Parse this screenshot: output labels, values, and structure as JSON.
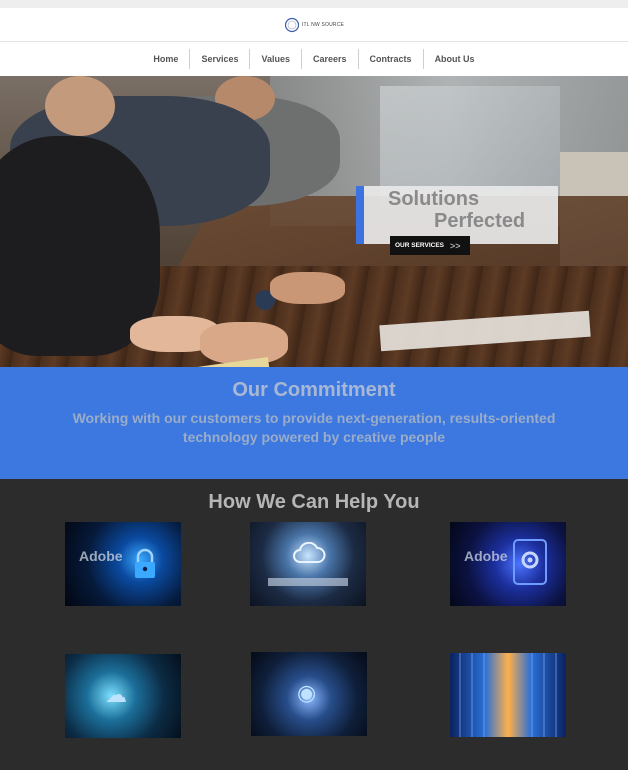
{
  "header": {
    "logo_text": "ITL NW SOURCE"
  },
  "nav": {
    "items": [
      "Home",
      "Services",
      "Values",
      "Careers",
      "Contracts",
      "About Us"
    ]
  },
  "hero": {
    "title_line1": "Solutions",
    "title_line2": "Perfected",
    "button_label": "OUR SERVICES",
    "button_arrow": ">>"
  },
  "commitment": {
    "title": "Our Commitment",
    "text": "Working with our customers to provide next-generation, results-oriented technology powered by creative people"
  },
  "help": {
    "title": "How We Can Help You",
    "tiles": [
      {
        "adobe": "Adobe",
        "icon": "lock-icon"
      },
      {
        "adobe": "",
        "icon": "cloud-icon"
      },
      {
        "adobe": "Adobe",
        "icon": "gear-icon"
      },
      {
        "adobe": "",
        "icon": "network-icon"
      },
      {
        "adobe": "",
        "icon": "tech-icon"
      },
      {
        "adobe": "",
        "icon": "server-icon"
      }
    ]
  },
  "colors": {
    "accent_blue": "#3c78e0",
    "dark_section": "#2c2c2c",
    "button_black": "#111111"
  }
}
